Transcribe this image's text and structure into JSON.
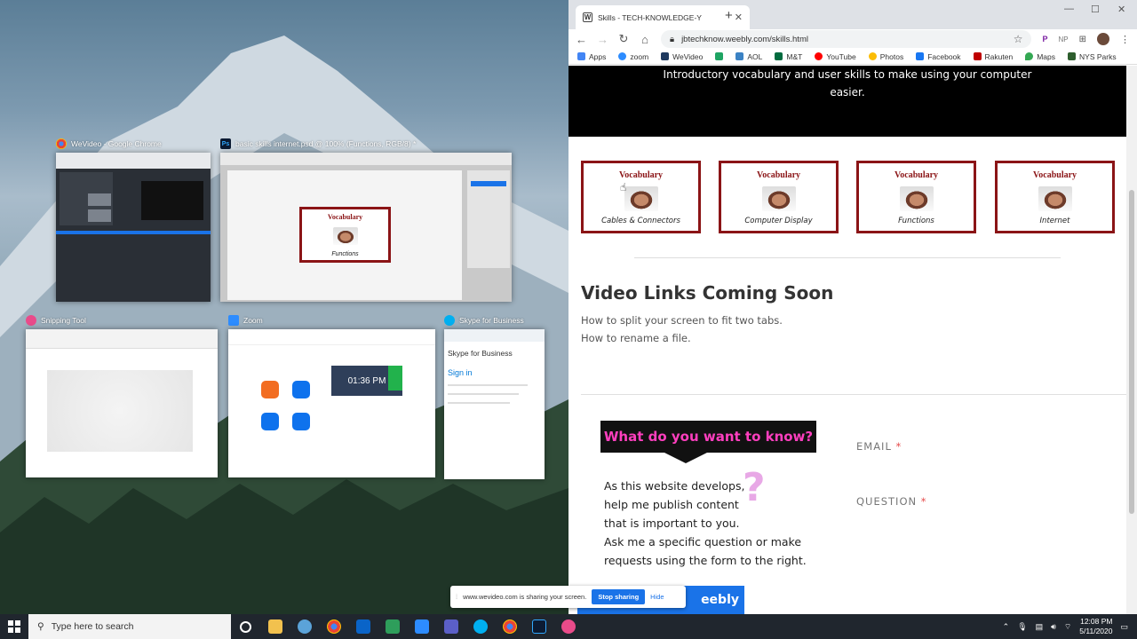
{
  "task_view": {
    "windows": [
      {
        "title": "WeVideo - Google Chrome",
        "icon": "chrome-icon"
      },
      {
        "title": "basic skills internet.psd @ 100% (Functions, RGB/8) *",
        "icon": "photoshop-icon"
      },
      {
        "title": "Snipping Tool",
        "icon": "snipping-tool-icon"
      },
      {
        "title": "Zoom",
        "icon": "zoom-icon"
      },
      {
        "title": "Skype for Business",
        "icon": "skype-icon"
      }
    ],
    "ps_card": {
      "title": "Vocabulary",
      "subtitle": "Functions"
    },
    "zoom_time": "01:36 PM",
    "skype": {
      "header": "Skype for Business",
      "sign_in": "Sign in"
    }
  },
  "browser": {
    "tab_title": "Skills - TECH-KNOWLEDGE-Y",
    "url": "jbtechknow.weebly.com/skills.html",
    "bookmarks": [
      {
        "label": "Apps",
        "color": "#4285f4"
      },
      {
        "label": "zoom",
        "color": "#2d8cff"
      },
      {
        "label": "WeVideo",
        "color": "#1f3a5f"
      },
      {
        "label": "",
        "color": "#1fa463"
      },
      {
        "label": "AOL",
        "color": "#3b82c4"
      },
      {
        "label": "M&T",
        "color": "#006b3f"
      },
      {
        "label": "YouTube",
        "color": "#ff0000"
      },
      {
        "label": "Photos",
        "color": "#fbbc05"
      },
      {
        "label": "Facebook",
        "color": "#1877f2"
      },
      {
        "label": "Rakuten",
        "color": "#bf0000"
      },
      {
        "label": "Maps",
        "color": "#34a853"
      },
      {
        "label": "NYS Parks",
        "color": "#2e5e2e"
      }
    ],
    "ext_label": "NP"
  },
  "page": {
    "hero_text": "Introductory vocabulary and user skills to make using your computer easier.",
    "cards": [
      {
        "title": "Vocabulary",
        "subtitle": "Cables & Connectors"
      },
      {
        "title": "Vocabulary",
        "subtitle": "Computer Display"
      },
      {
        "title": "Vocabulary",
        "subtitle": "Functions"
      },
      {
        "title": "Vocabulary",
        "subtitle": "Internet"
      }
    ],
    "video_links_title": "Video Links Coming Soon",
    "video_links": [
      "How to split your screen to fit two tabs.",
      "How to rename a file."
    ],
    "ask_banner": "What do you want to know?",
    "ask_lines": [
      "As this website develops,",
      "help me publish content",
      "that is important to you.",
      "Ask me a specific question or make",
      "requests using the form to the right."
    ],
    "qmark": "?",
    "email_label": "EMAIL",
    "question_label": "QUESTION",
    "required_mark": "*",
    "weebly_button": "eebly"
  },
  "sharebar": {
    "message": "www.wevideo.com is sharing your screen.",
    "stop": "Stop sharing",
    "hide": "Hide"
  },
  "taskbar": {
    "search_placeholder": "Type here to search",
    "time": "12:08 PM",
    "date": "5/11/2020"
  }
}
